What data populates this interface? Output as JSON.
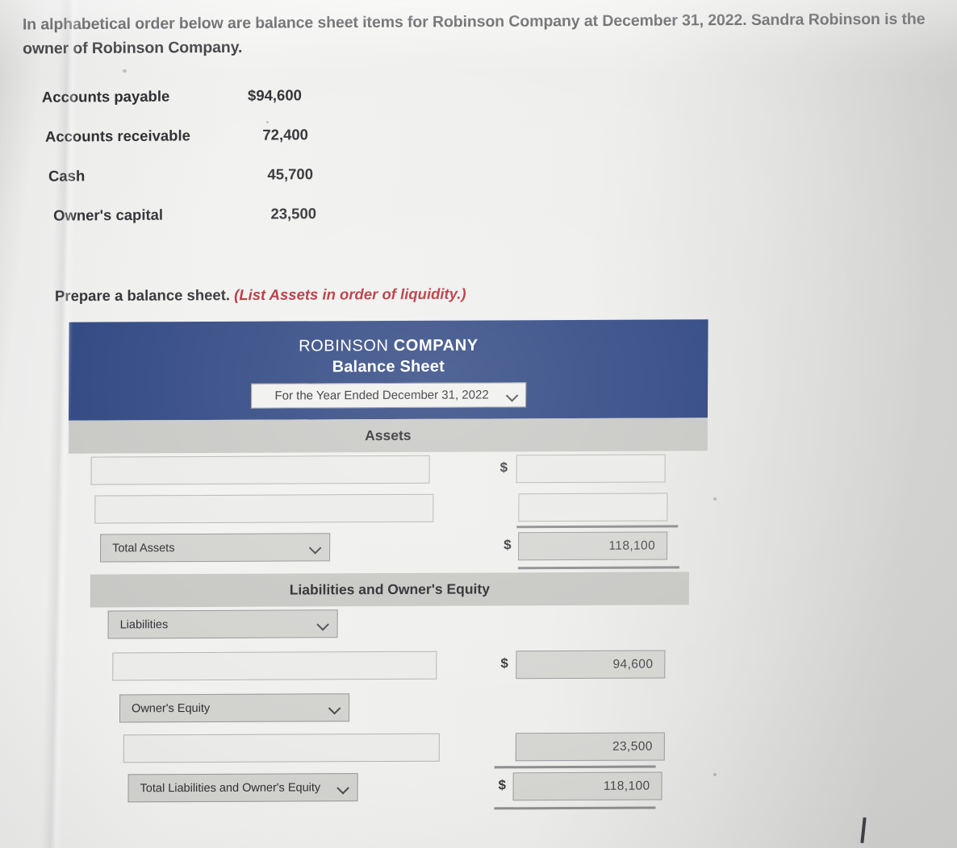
{
  "prompt": {
    "text": "In alphabetical order below are balance sheet items for Robinson Company at December 31, 2022. Sandra Robinson is the owner of Robinson Company."
  },
  "items": [
    {
      "label": "Accounts payable",
      "value": "$94,600"
    },
    {
      "label": "Accounts receivable",
      "value": "72,400"
    },
    {
      "label": "Cash",
      "value": "45,700"
    },
    {
      "label": "Owner's capital",
      "value": "23,500"
    }
  ],
  "instruction": {
    "main": "Prepare a balance sheet.",
    "hint": "(List Assets in order of liquidity.)"
  },
  "form": {
    "header": {
      "company_first": "ROBINSON ",
      "company_second": "COMPANY",
      "statement_title": "Balance Sheet",
      "period_selected": "For the Year Ended December 31, 2022",
      "background_color": "#2c4480"
    },
    "sections": {
      "assets_band": "Assets",
      "liabilities_band": "Liabilities and Owner's Equity"
    },
    "assets_rows": [
      {
        "account": "",
        "dollar": "$",
        "amount": ""
      },
      {
        "account": "",
        "dollar": "",
        "amount": ""
      }
    ],
    "total_assets": {
      "label": "Total Assets",
      "dollar": "$",
      "amount": "118,100"
    },
    "liabilities_select": "Liabilities",
    "liabilities_row": {
      "account": "",
      "dollar": "$",
      "amount": "94,600"
    },
    "owners_equity_select": "Owner's Equity",
    "owners_equity_row": {
      "account": "",
      "dollar": "",
      "amount": "23,500"
    },
    "total_liabilities_equity": {
      "label": "Total Liabilities and Owner's Equity",
      "dollar": "$",
      "amount": "118,100"
    }
  }
}
